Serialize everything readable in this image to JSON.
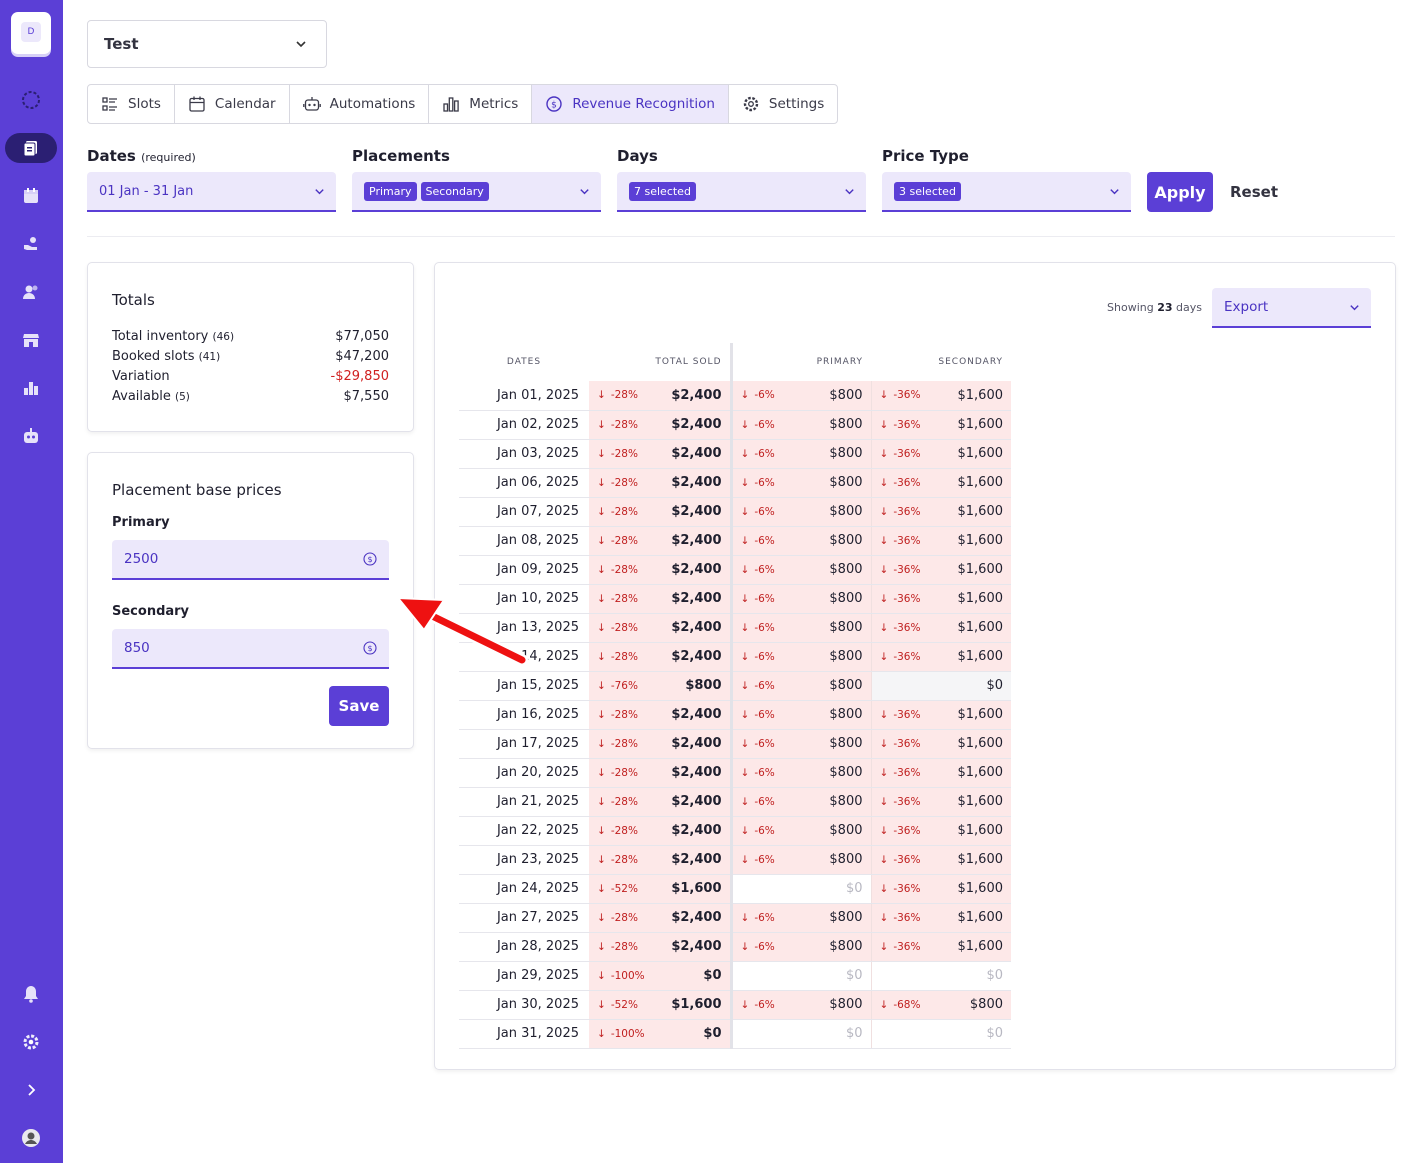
{
  "sidebar": {
    "logo_letter": "D"
  },
  "org_select": {
    "value": "Test"
  },
  "tabs": [
    {
      "label": "Slots"
    },
    {
      "label": "Calendar"
    },
    {
      "label": "Automations"
    },
    {
      "label": "Metrics"
    },
    {
      "label": "Revenue Recognition"
    },
    {
      "label": "Settings"
    }
  ],
  "filters": {
    "dates": {
      "label": "Dates",
      "hint": "(required)",
      "value": "01 Jan - 31 Jan"
    },
    "placements": {
      "label": "Placements",
      "chips": [
        "Primary",
        "Secondary"
      ]
    },
    "days": {
      "label": "Days",
      "chip": "7 selected"
    },
    "price_type": {
      "label": "Price Type",
      "chip": "3 selected"
    },
    "apply_label": "Apply",
    "reset_label": "Reset"
  },
  "totals": {
    "title": "Totals",
    "rows": [
      {
        "label": "Total inventory",
        "count": "(46)",
        "value": "$77,050"
      },
      {
        "label": "Booked slots",
        "count": "(41)",
        "value": "$47,200"
      },
      {
        "label": "Variation",
        "count": "",
        "value": "-$29,850"
      },
      {
        "label": "Available",
        "count": "(5)",
        "value": "$7,550"
      }
    ]
  },
  "base_prices": {
    "title": "Placement base prices",
    "primary_label": "Primary",
    "primary_value": "2500",
    "secondary_label": "Secondary",
    "secondary_value": "850",
    "save_label": "Save"
  },
  "table": {
    "showing_prefix": "Showing",
    "showing_count": "23",
    "showing_suffix": "days",
    "export_label": "Export",
    "headers": [
      "DATES",
      "TOTAL SOLD",
      "PRIMARY",
      "SECONDARY"
    ],
    "rows": [
      {
        "date": "Jan 01, 2025",
        "t_pct": "-28%",
        "t_val": "$2,400",
        "p_pct": "-6%",
        "p_val": "$800",
        "s_pct": "-36%",
        "s_val": "$1,600"
      },
      {
        "date": "Jan 02, 2025",
        "t_pct": "-28%",
        "t_val": "$2,400",
        "p_pct": "-6%",
        "p_val": "$800",
        "s_pct": "-36%",
        "s_val": "$1,600"
      },
      {
        "date": "Jan 03, 2025",
        "t_pct": "-28%",
        "t_val": "$2,400",
        "p_pct": "-6%",
        "p_val": "$800",
        "s_pct": "-36%",
        "s_val": "$1,600"
      },
      {
        "date": "Jan 06, 2025",
        "t_pct": "-28%",
        "t_val": "$2,400",
        "p_pct": "-6%",
        "p_val": "$800",
        "s_pct": "-36%",
        "s_val": "$1,600"
      },
      {
        "date": "Jan 07, 2025",
        "t_pct": "-28%",
        "t_val": "$2,400",
        "p_pct": "-6%",
        "p_val": "$800",
        "s_pct": "-36%",
        "s_val": "$1,600"
      },
      {
        "date": "Jan 08, 2025",
        "t_pct": "-28%",
        "t_val": "$2,400",
        "p_pct": "-6%",
        "p_val": "$800",
        "s_pct": "-36%",
        "s_val": "$1,600"
      },
      {
        "date": "Jan 09, 2025",
        "t_pct": "-28%",
        "t_val": "$2,400",
        "p_pct": "-6%",
        "p_val": "$800",
        "s_pct": "-36%",
        "s_val": "$1,600"
      },
      {
        "date": "Jan 10, 2025",
        "t_pct": "-28%",
        "t_val": "$2,400",
        "p_pct": "-6%",
        "p_val": "$800",
        "s_pct": "-36%",
        "s_val": "$1,600"
      },
      {
        "date": "Jan 13, 2025",
        "t_pct": "-28%",
        "t_val": "$2,400",
        "p_pct": "-6%",
        "p_val": "$800",
        "s_pct": "-36%",
        "s_val": "$1,600"
      },
      {
        "date": "14, 2025",
        "t_pct": "-28%",
        "t_val": "$2,400",
        "p_pct": "-6%",
        "p_val": "$800",
        "s_pct": "-36%",
        "s_val": "$1,600"
      },
      {
        "date": "Jan 15, 2025",
        "t_pct": "-76%",
        "t_val": "$800",
        "p_pct": "-6%",
        "p_val": "$800",
        "s_pct": "",
        "s_val": "$0"
      },
      {
        "date": "Jan 16, 2025",
        "t_pct": "-28%",
        "t_val": "$2,400",
        "p_pct": "-6%",
        "p_val": "$800",
        "s_pct": "-36%",
        "s_val": "$1,600"
      },
      {
        "date": "Jan 17, 2025",
        "t_pct": "-28%",
        "t_val": "$2,400",
        "p_pct": "-6%",
        "p_val": "$800",
        "s_pct": "-36%",
        "s_val": "$1,600"
      },
      {
        "date": "Jan 20, 2025",
        "t_pct": "-28%",
        "t_val": "$2,400",
        "p_pct": "-6%",
        "p_val": "$800",
        "s_pct": "-36%",
        "s_val": "$1,600"
      },
      {
        "date": "Jan 21, 2025",
        "t_pct": "-28%",
        "t_val": "$2,400",
        "p_pct": "-6%",
        "p_val": "$800",
        "s_pct": "-36%",
        "s_val": "$1,600"
      },
      {
        "date": "Jan 22, 2025",
        "t_pct": "-28%",
        "t_val": "$2,400",
        "p_pct": "-6%",
        "p_val": "$800",
        "s_pct": "-36%",
        "s_val": "$1,600"
      },
      {
        "date": "Jan 23, 2025",
        "t_pct": "-28%",
        "t_val": "$2,400",
        "p_pct": "-6%",
        "p_val": "$800",
        "s_pct": "-36%",
        "s_val": "$1,600"
      },
      {
        "date": "Jan 24, 2025",
        "t_pct": "-52%",
        "t_val": "$1,600",
        "p_pct": "",
        "p_val": "$0",
        "s_pct": "-36%",
        "s_val": "$1,600"
      },
      {
        "date": "Jan 27, 2025",
        "t_pct": "-28%",
        "t_val": "$2,400",
        "p_pct": "-6%",
        "p_val": "$800",
        "s_pct": "-36%",
        "s_val": "$1,600"
      },
      {
        "date": "Jan 28, 2025",
        "t_pct": "-28%",
        "t_val": "$2,400",
        "p_pct": "-6%",
        "p_val": "$800",
        "s_pct": "-36%",
        "s_val": "$1,600"
      },
      {
        "date": "Jan 29, 2025",
        "t_pct": "-100%",
        "t_val": "$0",
        "p_pct": "",
        "p_val": "$0",
        "s_pct": "",
        "s_val": "$0"
      },
      {
        "date": "Jan 30, 2025",
        "t_pct": "-52%",
        "t_val": "$1,600",
        "p_pct": "-6%",
        "p_val": "$800",
        "s_pct": "-68%",
        "s_val": "$800"
      },
      {
        "date": "Jan 31, 2025",
        "t_pct": "-100%",
        "t_val": "$0",
        "p_pct": "",
        "p_val": "$0",
        "s_pct": "",
        "s_val": "$0"
      }
    ]
  },
  "colors": {
    "accent": "#5b3fd6",
    "negative": "#d02020",
    "negative_bg": "#fde8e8"
  }
}
